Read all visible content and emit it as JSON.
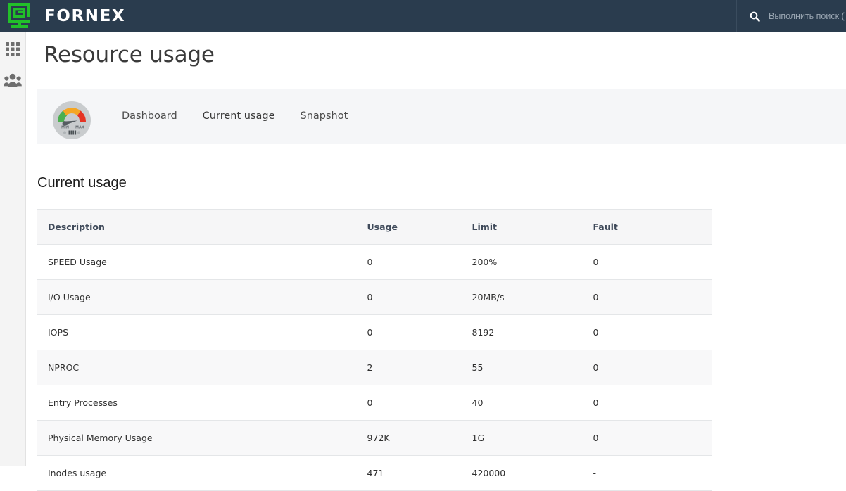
{
  "header": {
    "brand_name": "FORNEX",
    "logo_icon": "fornex-logo-icon",
    "search_icon": "search-icon",
    "search_placeholder": "Выполнить поиск ( / )",
    "background_color": "#2a3c4e",
    "logo_color": "#22c02a"
  },
  "sidebar": {
    "items": [
      {
        "icon": "apps-grid-icon",
        "name": "apps"
      },
      {
        "icon": "users-group-icon",
        "name": "users"
      }
    ]
  },
  "page": {
    "title": "Resource usage"
  },
  "tabpanel": {
    "gauge_icon": "gauge-icon",
    "gauge_min_label": "MIN",
    "gauge_max_label": "MAX",
    "active_color": "#0a8ef0",
    "tabs": [
      {
        "label": "Dashboard",
        "active": false
      },
      {
        "label": "Current usage",
        "active": true
      },
      {
        "label": "Snapshot",
        "active": false
      }
    ]
  },
  "section": {
    "title": "Current usage"
  },
  "table": {
    "columns": [
      "Description",
      "Usage",
      "Limit",
      "Fault"
    ],
    "rows": [
      {
        "description": "SPEED Usage",
        "usage": "0",
        "limit": "200%",
        "fault": "0"
      },
      {
        "description": "I/O Usage",
        "usage": "0",
        "limit": "20MB/s",
        "fault": "0"
      },
      {
        "description": "IOPS",
        "usage": "0",
        "limit": "8192",
        "fault": "0"
      },
      {
        "description": "NPROC",
        "usage": "2",
        "limit": "55",
        "fault": "0"
      },
      {
        "description": "Entry Processes",
        "usage": "0",
        "limit": "40",
        "fault": "0"
      },
      {
        "description": "Physical Memory Usage",
        "usage": "972K",
        "limit": "1G",
        "fault": "0"
      },
      {
        "description": "Inodes usage",
        "usage": "471",
        "limit": "420000",
        "fault": "-"
      }
    ]
  }
}
